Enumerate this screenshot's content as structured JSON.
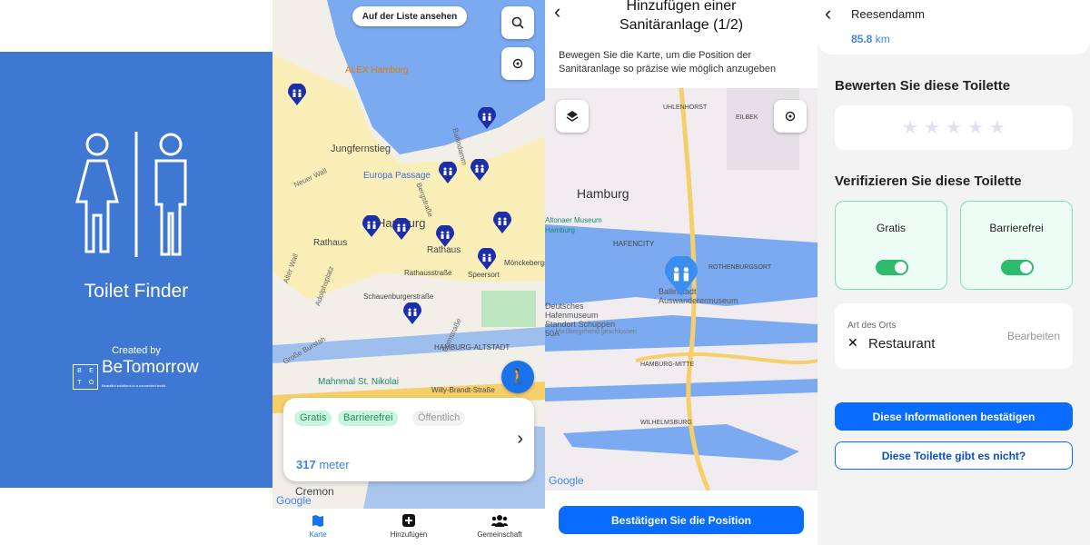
{
  "splash": {
    "app_name": "Toilet Finder",
    "created_by": "Created by",
    "brand": "BeTomorrow",
    "brand_grid": [
      "B",
      "E",
      "T",
      "O"
    ],
    "brand_tagline": "Beautiful solutions in a connected world",
    "bg_color": "#3f78d3"
  },
  "map_screen": {
    "list_button": "Auf der Liste ansehen",
    "labels": [
      "ALEX Hamburg",
      "Jungfernstieg",
      "Europa Passage",
      "Hamburg",
      "Rathaus",
      "Rathaus",
      "Speersort",
      "Mönckebergstraße",
      "Rathausstraße",
      "Schauenburgerstraße",
      "HAMBURG-ALTSTADT",
      "Mahnmal St. Nikolai",
      "Willy-Brandt-Straße",
      "Cremon",
      "Neuer Wall",
      "Ballindamm",
      "Bergstraße",
      "Domstraße",
      "Große Burstah",
      "Alter Wall",
      "Adolphsplatz"
    ],
    "card": {
      "chips": [
        "Gratis",
        "Barrierefrei",
        "Öffentlich"
      ],
      "distance_value": "317",
      "distance_unit": "meter"
    },
    "nav": [
      {
        "label": "Karte",
        "icon": "map-icon",
        "active": true
      },
      {
        "label": "Hinzufügen",
        "icon": "add-icon"
      },
      {
        "label": "Gemeinschaft",
        "icon": "community-icon"
      }
    ],
    "google": "Google",
    "accent": "#1a73e8"
  },
  "add_screen": {
    "title": "Hinzufügen einer Sanitäranlage (1/2)",
    "instructions": "Bewegen Sie die Karte, um die Position der Sanitäranlage so präzise wie möglich anzugeben",
    "labels": [
      "Hamburg",
      "HAFENCITY",
      "ROTHENBURGSORT",
      "Ballinstadt Auswanderermuseum",
      "Deutsches Hafenmuseum Standort Schuppen 50A",
      "HAMBURG-MITTE",
      "WILHELMSBURG",
      "UHLENHORST",
      "EILBEK",
      "Altonaer Museum",
      "Hamburg",
      "Vorübergehend geschlossen"
    ],
    "confirm_button": "Bestätigen Sie die Position",
    "google": "Google"
  },
  "detail_screen": {
    "name": "Reesendamm",
    "distance_value": "85.8",
    "distance_unit": "km",
    "rate_heading": "Bewerten Sie diese Toilette",
    "rating": 0,
    "rating_max": 5,
    "verify_heading": "Verifizieren Sie diese Toilette",
    "toggles": [
      {
        "label": "Gratis",
        "on": true
      },
      {
        "label": "Barrierefrei",
        "on": true
      }
    ],
    "place_type_label": "Art des Orts",
    "place_type": "Restaurant",
    "edit": "Bearbeiten",
    "confirm_button": "Diese Informationen bestätigen",
    "not_exist_button": "Diese Toilette gibt es nicht?",
    "primary_color": "#0a6cff",
    "toggle_color": "#2dbb6d"
  }
}
